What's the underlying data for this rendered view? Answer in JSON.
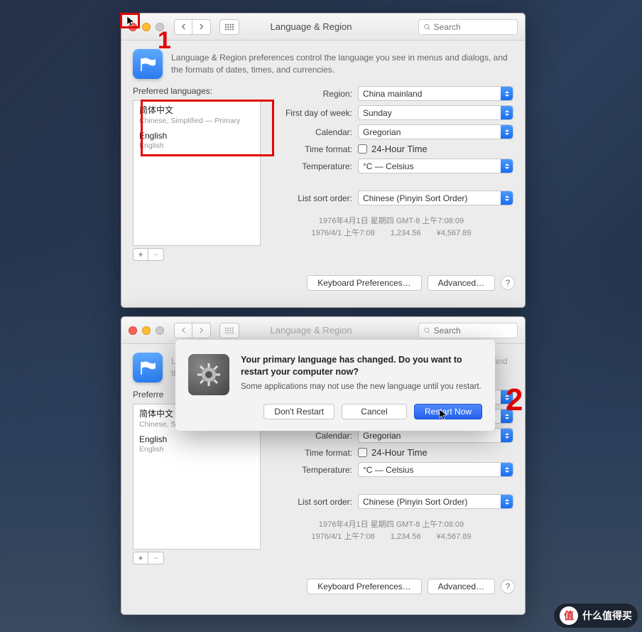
{
  "window": {
    "title": "Language & Region",
    "search_placeholder": "Search",
    "description": "Language & Region preferences control the language you see in menus and dialogs, and the formats of dates, times, and currencies."
  },
  "preferred_languages": {
    "label": "Preferred languages:",
    "items": [
      {
        "name": "简体中文",
        "sub": "Chinese, Simplified — Primary"
      },
      {
        "name": "English",
        "sub": "English"
      }
    ]
  },
  "form": {
    "region": {
      "label": "Region:",
      "value": "China mainland"
    },
    "first_day": {
      "label": "First day of week:",
      "value": "Sunday"
    },
    "calendar": {
      "label": "Calendar:",
      "value": "Gregorian"
    },
    "time_format": {
      "label": "Time format:",
      "checkbox_label": "24-Hour Time"
    },
    "temperature": {
      "label": "Temperature:",
      "value": "°C — Celsius"
    },
    "list_sort": {
      "label": "List sort order:",
      "value": "Chinese (Pinyin Sort Order)"
    }
  },
  "samples": {
    "line1": "1976年4月1日 星期四 GMT-8 上午7:08:09",
    "line2": "1976/4/1 上午7:08　　1,234.56　　¥4,567.89"
  },
  "footer": {
    "keyboard": "Keyboard Preferences…",
    "advanced": "Advanced…",
    "help": "?"
  },
  "dialog": {
    "title": "Your primary language has changed. Do you want to restart your computer now?",
    "sub": "Some applications may not use the new language until you restart.",
    "dont_restart": "Don't Restart",
    "cancel": "Cancel",
    "restart_now": "Restart Now"
  },
  "second_window": {
    "pref_label_truncated": "Preferre"
  },
  "annotations": {
    "one": "1",
    "two": "2"
  },
  "watermark": {
    "badge": "值",
    "text": "什么值得买"
  }
}
